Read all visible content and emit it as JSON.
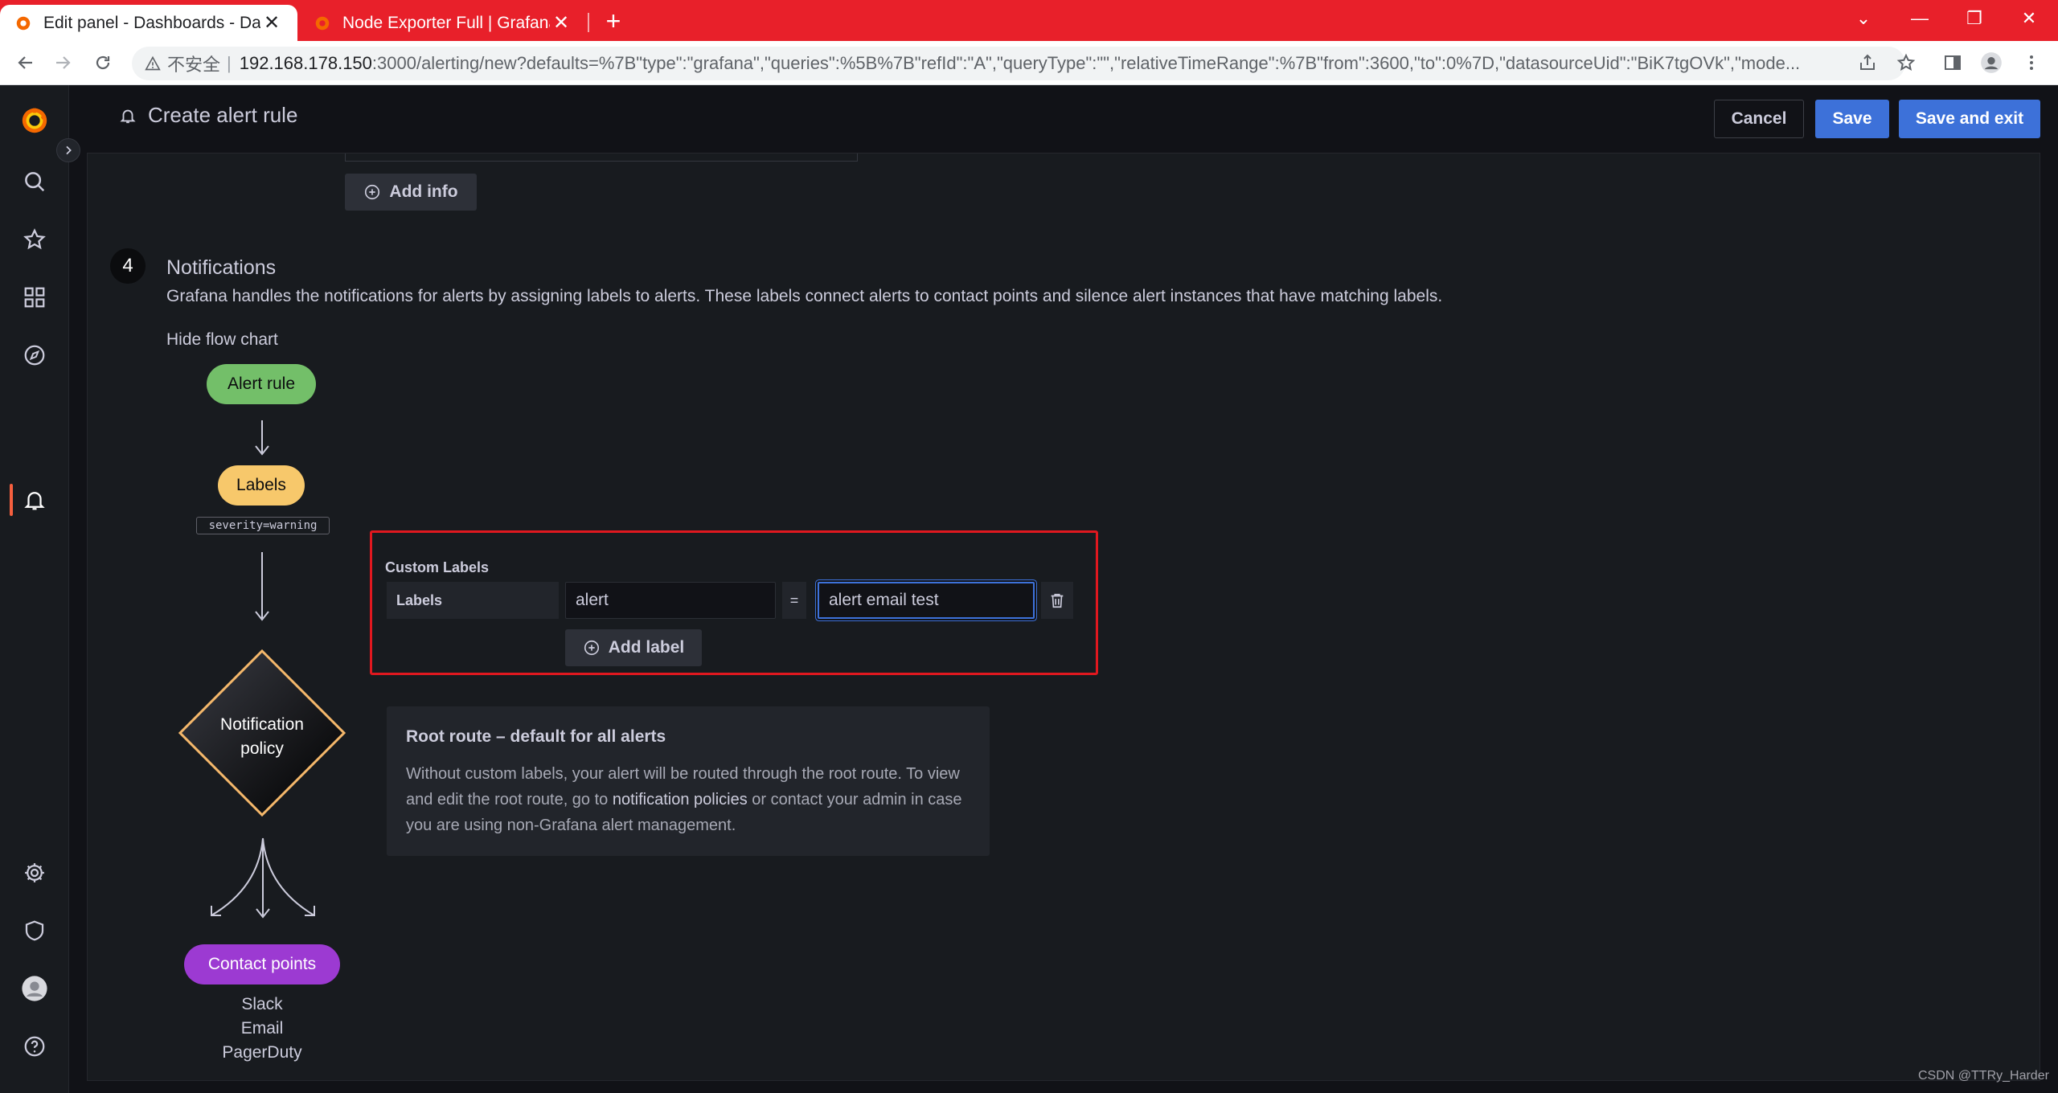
{
  "browser": {
    "tabs": [
      {
        "title": "Edit panel - Dashboards - Dashboards",
        "close": "✕"
      },
      {
        "title": "Node Exporter Full | Grafana Labs",
        "close": "✕"
      }
    ],
    "new_tab": "+",
    "window_controls": {
      "minimize": "—",
      "restore": "❐",
      "close": "✕",
      "dropdown": "⌄"
    },
    "address": {
      "security_label": "不安全",
      "host": "192.168.178.150",
      "path": ":3000/alerting/new?defaults=%7B\"type\":\"grafana\",\"queries\":%5B%7B\"refId\":\"A\",\"queryType\":\"\",\"relativeTimeRange\":%7B\"from\":3600,\"to\":0%7D,\"datasourceUid\":\"BiK7tgOVk\",\"mode..."
    }
  },
  "app": {
    "page_title": "Create alert rule",
    "buttons": {
      "cancel": "Cancel",
      "save": "Save",
      "save_exit": "Save and exit"
    },
    "add_info": "Add info",
    "notifications": {
      "step": "4",
      "title": "Notifications",
      "description": "Grafana handles the notifications for alerts by assigning labels to alerts. These labels connect alerts to contact points and silence alert instances that have matching labels.",
      "hide_flow": "Hide flow chart"
    },
    "flow": {
      "alert_rule": "Alert rule",
      "labels": "Labels",
      "label_example": "severity=warning",
      "policy_line1": "Notification",
      "policy_line2": "policy",
      "contact_points": "Contact points",
      "integrations": [
        "Slack",
        "Email",
        "PagerDuty"
      ]
    },
    "custom_labels": {
      "title": "Custom Labels",
      "key_heading": "Labels",
      "key_value": "alert",
      "operator": "=",
      "value_value": "alert email test",
      "add_label": "Add label"
    },
    "root_route": {
      "title": "Root route – default for all alerts",
      "text_before": "Without custom labels, your alert will be routed through the root route. To view and edit the root route, go to ",
      "link": "notification policies",
      "text_after": " or contact your admin in case you are using non-Grafana alert management."
    },
    "colors": {
      "accent": "#3d71d9",
      "alert_rule": "#73bf69",
      "labels": "#f7c86b",
      "contact_points": "#9c3ad2",
      "highlight": "#e0181f"
    }
  },
  "watermark": "CSDN @TTRy_Harder"
}
